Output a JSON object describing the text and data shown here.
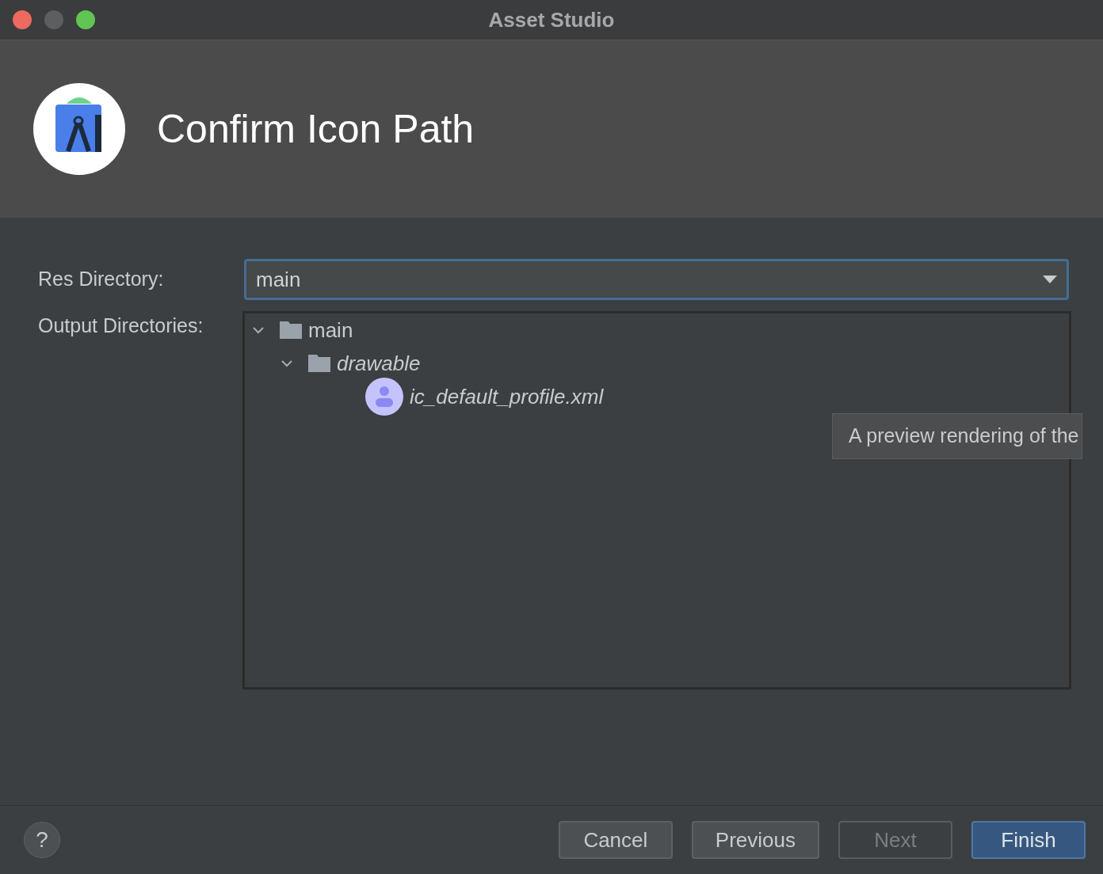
{
  "window": {
    "title": "Asset Studio"
  },
  "header": {
    "title": "Confirm Icon Path"
  },
  "res_directory": {
    "label": "Res Directory:",
    "value": "main"
  },
  "output_directories": {
    "label": "Output Directories:",
    "tree": [
      {
        "kind": "folder",
        "name": "main",
        "expanded": true,
        "emphasized": false,
        "children": [
          {
            "kind": "folder",
            "name": "drawable",
            "expanded": true,
            "emphasized": true,
            "children": [
              {
                "kind": "file",
                "name": "ic_default_profile.xml",
                "emphasized": true
              }
            ]
          }
        ]
      }
    ]
  },
  "tooltip": "A preview rendering of the",
  "footer": {
    "help": "?",
    "buttons": [
      {
        "kind": "normal",
        "label": "Cancel",
        "disabled": false
      },
      {
        "kind": "normal",
        "label": "Previous",
        "disabled": false
      },
      {
        "kind": "normal",
        "label": "Next",
        "disabled": true
      },
      {
        "kind": "primary",
        "label": "Finish",
        "disabled": false
      }
    ]
  }
}
